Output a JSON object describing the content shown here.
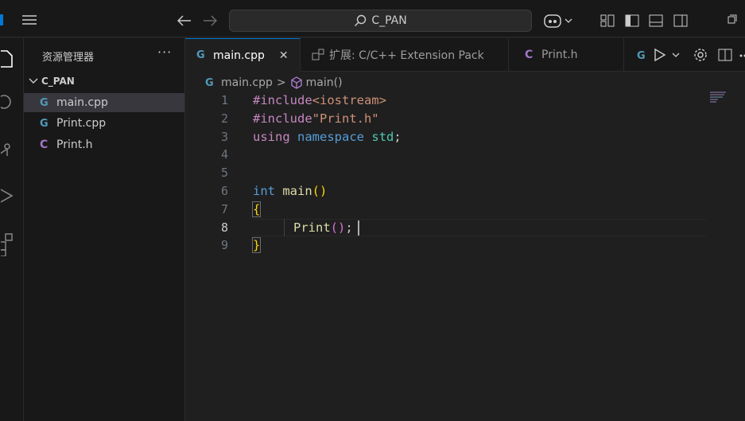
{
  "titlebar": {
    "search_text": "C_PAN"
  },
  "sidebar": {
    "title": "资源管理器",
    "more": "···",
    "folder": "C_PAN",
    "files": [
      {
        "name": "main.cpp",
        "glyph": "G",
        "active": true
      },
      {
        "name": "Print.cpp",
        "glyph": "G",
        "active": false
      },
      {
        "name": "Print.h",
        "glyph": "C",
        "active": false
      }
    ]
  },
  "tabs": [
    {
      "label": "main.cpp",
      "glyph": "G",
      "active": true,
      "close": "✕"
    },
    {
      "label": "扩展: C/C++ Extension Pack",
      "glyph": "",
      "active": false
    },
    {
      "label": "Print.h",
      "glyph": "C",
      "active": false
    }
  ],
  "breadcrumb": {
    "file": "main.cpp",
    "separator": ">",
    "symbol": "main()"
  },
  "editor": {
    "line_numbers": [
      "1",
      "2",
      "3",
      "4",
      "5",
      "6",
      "7",
      "8",
      "9"
    ],
    "current_line": "8",
    "lines": {
      "l1_directive": "#include",
      "l1_header": "<iostream>",
      "l2_directive": "#include",
      "l2_header": "\"Print.h\"",
      "l3_using": "using",
      "l3_namespace": "namespace",
      "l3_std": "std",
      "l3_semi": ";",
      "l6_int": "int",
      "l6_main": "main",
      "l6_parens": "()",
      "l7_brace": "{",
      "l8_print": "Print",
      "l8_parens": "()",
      "l8_semi": ";",
      "l9_brace": "}"
    }
  },
  "colors": {
    "accent": "#0078d4",
    "cpp_icon": "#519aba",
    "h_icon": "#a074c4"
  }
}
